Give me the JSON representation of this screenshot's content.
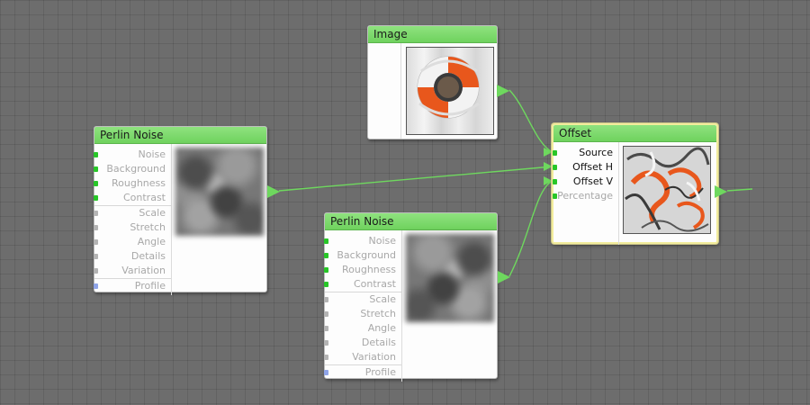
{
  "nodes": {
    "image": {
      "title": "Image"
    },
    "perlin1": {
      "title": "Perlin Noise",
      "params": [
        "Noise",
        "Background",
        "Roughness",
        "Contrast",
        "Scale",
        "Stretch",
        "Angle",
        "Details",
        "Variation",
        "Profile"
      ]
    },
    "perlin2": {
      "title": "Perlin Noise",
      "params": [
        "Noise",
        "Background",
        "Roughness",
        "Contrast",
        "Scale",
        "Stretch",
        "Angle",
        "Details",
        "Variation",
        "Profile"
      ]
    },
    "offset": {
      "title": "Offset",
      "params": [
        "Source",
        "Offset H",
        "Offset V",
        "Percentage"
      ]
    }
  },
  "colors": {
    "wire": "#6ed85e",
    "title_bar": "#7fdc6e",
    "port_green": "#28c628",
    "port_gray": "#b4b4b4",
    "port_blue": "#8fa4e8",
    "selection": "#f2ec9c",
    "lifebuoy_orange": "#e8571c"
  },
  "icons": {
    "output_port": "triangle-right-icon",
    "input_port": "square-dot-icon"
  }
}
